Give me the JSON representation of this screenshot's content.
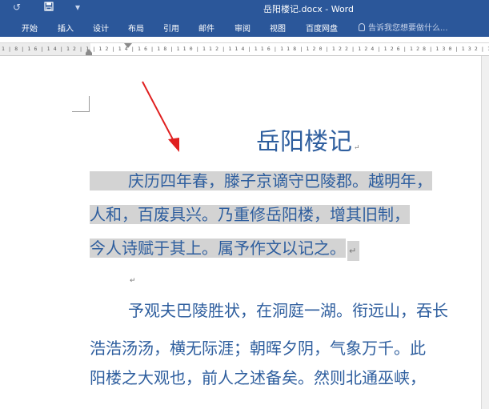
{
  "title_bar": {
    "title": "岳阳楼记.docx - Word",
    "undo_icon": "↺",
    "save_icon": "save-icon",
    "customize_icon": "▾"
  },
  "ribbon": {
    "tabs": [
      "开始",
      "插入",
      "设计",
      "布局",
      "引用",
      "邮件",
      "审阅",
      "视图",
      "百度网盘"
    ],
    "tell_me_placeholder": "告诉我您想要做什么..."
  },
  "ruler": {
    "labels": "1 | 8 | 1 6 | 1 4 | 1 2 | 1 | 1 2 | 1 4 | 1 6 | 1 8 | 1 1 0 | 1 1 2 | 1 1 4 | 1 1 6 | 1 1 8 | 1 2 0 | 1 2 2 | 1 2 4 | 1 2 6 | 1 2 8 | 1 3 0 | 1 3 2 | 1 3 4"
  },
  "document": {
    "heading": "岳阳楼记",
    "paragraph_mark": "↵",
    "lines_selected": [
      "庆历四年春，滕子京谪守巴陵郡。越明年，",
      "人和，百废具兴。乃重修岳阳楼，增其旧制，",
      "今人诗赋于其上。属予作文以记之。"
    ],
    "lines_unselected": [
      "予观夫巴陵胜状，在洞庭一湖。衔远山，吞长",
      "浩浩汤汤，横无际涯；朝晖夕阴，气象万千。此",
      "阳楼之大观也，前人之述备矣。然则北通巫峡，"
    ]
  },
  "colors": {
    "ribbon_blue": "#2b579a",
    "text_blue": "#2e5e9e",
    "selection_gray": "#d3d3d3",
    "arrow_red": "#e02020"
  }
}
